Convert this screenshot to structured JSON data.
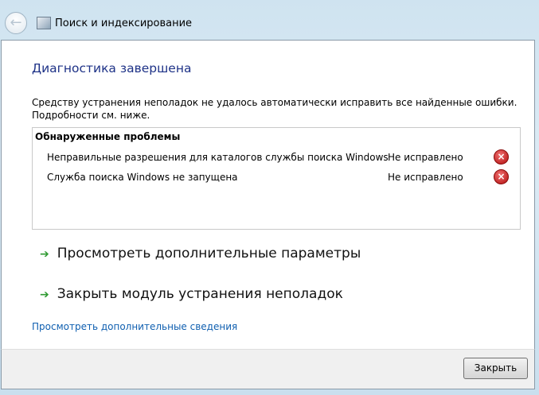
{
  "window": {
    "title": "Поиск и индексирование"
  },
  "main": {
    "heading": "Диагностика завершена",
    "description": "Средству устранения неполадок не удалось автоматически исправить все найденные ошибки. Подробности см. ниже.",
    "problems_header": "Обнаруженные проблемы",
    "problems": [
      {
        "name": "Неправильные разрешения для каталогов службы поиска Windows",
        "status": "Не исправлено",
        "icon": "error-icon"
      },
      {
        "name": "Служба поиска Windows не запущена",
        "status": "Не исправлено",
        "icon": "error-icon"
      }
    ],
    "commands": [
      {
        "label": "Просмотреть дополнительные параметры"
      },
      {
        "label": "Закрыть модуль устранения неполадок"
      }
    ],
    "details_link": "Просмотреть дополнительные сведения"
  },
  "footer": {
    "close_label": "Закрыть"
  }
}
